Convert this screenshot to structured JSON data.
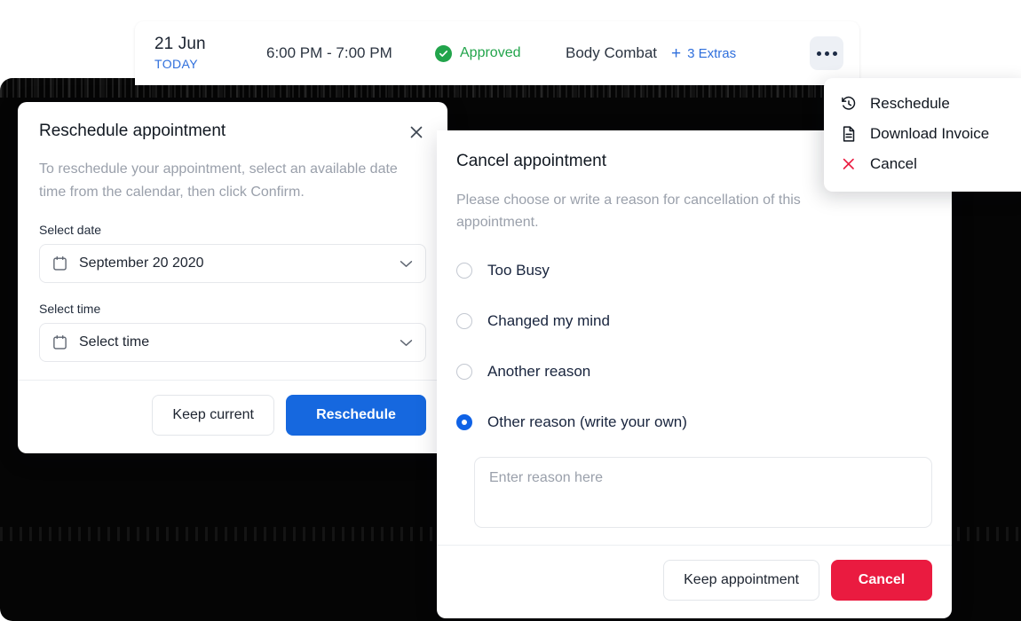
{
  "appointment_bar": {
    "date": "21 Jun",
    "day_tag": "TODAY",
    "time_range": "6:00 PM - 7:00 PM",
    "status": "Approved",
    "status_icon": "check-circle-icon",
    "status_color": "#22a44b",
    "class_name": "Body Combat",
    "extras_plus": "+",
    "extras_label": "3 Extras",
    "extras_color": "#2f6fdc",
    "more_icon": "kebab-menu-icon"
  },
  "context_menu": {
    "items": [
      {
        "label": "Reschedule",
        "icon": "history-rewind-icon",
        "icon_color": "#10161f"
      },
      {
        "label": "Download Invoice",
        "icon": "document-icon",
        "icon_color": "#10161f"
      },
      {
        "label": "Cancel",
        "icon": "close-x-icon",
        "icon_color": "#ea1b40"
      }
    ]
  },
  "reschedule_dialog": {
    "title": "Reschedule appointment",
    "close_icon": "close-icon",
    "description": "To reschedule your appointment, select an available date time from the calendar, then click Confirm.",
    "date_label": "Select date",
    "date_value": "September 20 2020",
    "date_icon": "calendar-icon",
    "time_label": "Select time",
    "time_value": "Select time",
    "time_icon": "calendar-icon",
    "chevron_icon": "chevron-down-icon",
    "secondary_button": "Keep current",
    "primary_button": "Reschedule",
    "primary_color": "#1668df"
  },
  "cancel_dialog": {
    "title": "Cancel appointment",
    "description": "Please choose or write a reason for cancellation of this appointment.",
    "options": [
      {
        "label": "Too Busy",
        "selected": false
      },
      {
        "label": "Changed my mind",
        "selected": false
      },
      {
        "label": "Another reason",
        "selected": false
      },
      {
        "label": "Other reason (write your own)",
        "selected": true
      }
    ],
    "reason_value": "",
    "reason_placeholder": "Enter reason here",
    "secondary_button": "Keep appointment",
    "primary_button": "Cancel",
    "primary_color": "#ea1b40"
  }
}
